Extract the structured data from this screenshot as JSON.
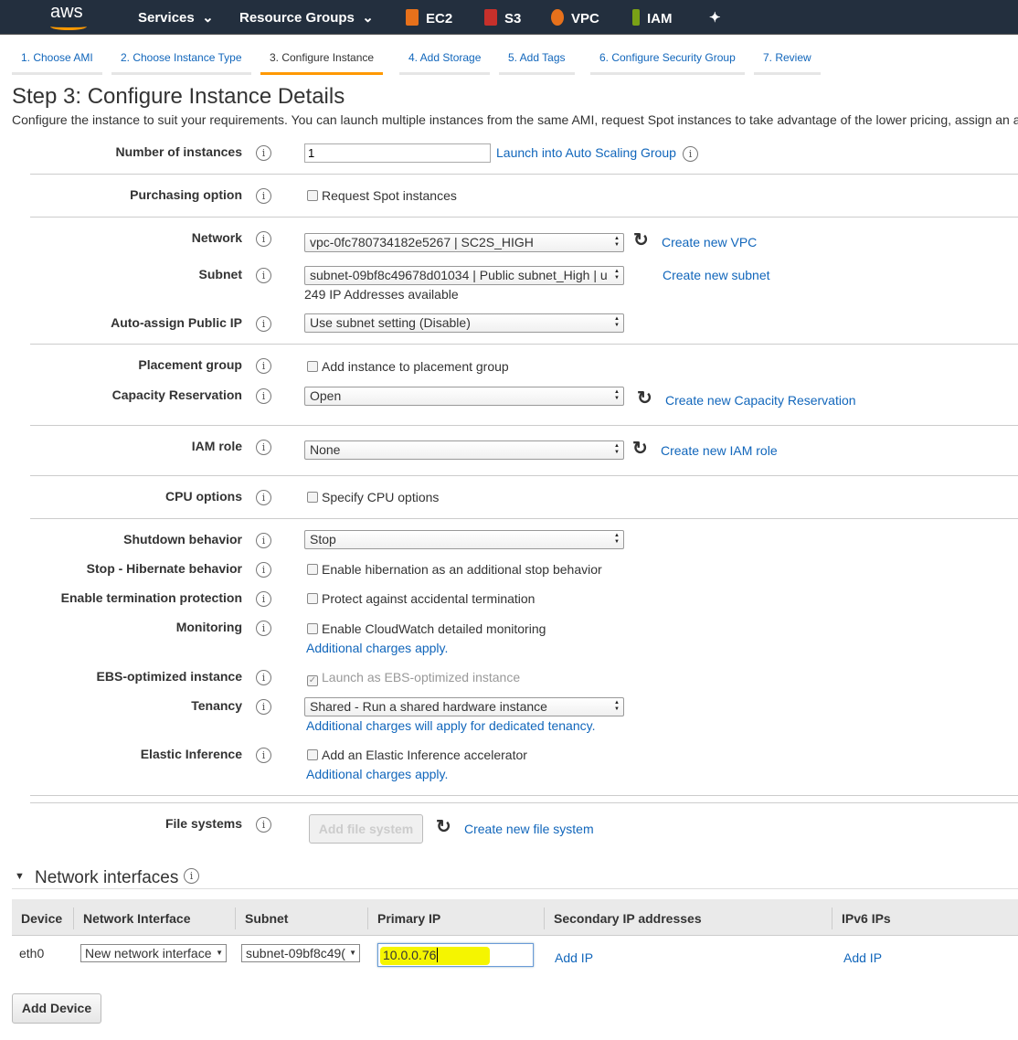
{
  "nav": {
    "logo": "aws",
    "services": "Services",
    "resource_groups": "Resource Groups",
    "ec2": "EC2",
    "s3": "S3",
    "vpc": "VPC",
    "iam": "IAM",
    "colors": {
      "bg": "#232f3e",
      "accent": "#ff9900"
    }
  },
  "steps": [
    "1. Choose AMI",
    "2. Choose Instance Type",
    "3. Configure Instance",
    "4. Add Storage",
    "5. Add Tags",
    "6. Configure Security Group",
    "7. Review"
  ],
  "title": "Step 3: Configure Instance Details",
  "description": "Configure the instance to suit your requirements. You can launch multiple instances from the same AMI, request Spot instances to take advantage of the lower pricing, assign an a",
  "form": {
    "num_instances": {
      "label": "Number of instances",
      "value": "1",
      "link": "Launch into Auto Scaling Group"
    },
    "purchasing": {
      "label": "Purchasing option",
      "checkbox": "Request Spot instances"
    },
    "network": {
      "label": "Network",
      "value": "vpc-0fc780734182e5267 | SC2S_HIGH",
      "link": "Create new VPC"
    },
    "subnet": {
      "label": "Subnet",
      "value": "subnet-09bf8c49678d01034 | Public subnet_High | u",
      "link": "Create new subnet",
      "note": "249 IP Addresses available"
    },
    "public_ip": {
      "label": "Auto-assign Public IP",
      "value": "Use subnet setting (Disable)"
    },
    "placement": {
      "label": "Placement group",
      "checkbox": "Add instance to placement group"
    },
    "capacity": {
      "label": "Capacity Reservation",
      "value": "Open",
      "link": "Create new Capacity Reservation"
    },
    "iam": {
      "label": "IAM role",
      "value": "None",
      "link": "Create new IAM role"
    },
    "cpu": {
      "label": "CPU options",
      "checkbox": "Specify CPU options"
    },
    "shutdown": {
      "label": "Shutdown behavior",
      "value": "Stop"
    },
    "hibernate": {
      "label": "Stop - Hibernate behavior",
      "checkbox": "Enable hibernation as an additional stop behavior"
    },
    "termination": {
      "label": "Enable termination protection",
      "checkbox": "Protect against accidental termination"
    },
    "monitoring": {
      "label": "Monitoring",
      "checkbox": "Enable CloudWatch detailed monitoring",
      "link": "Additional charges apply."
    },
    "ebs": {
      "label": "EBS-optimized instance",
      "checkbox": "Launch as EBS-optimized instance"
    },
    "tenancy": {
      "label": "Tenancy",
      "value": "Shared - Run a shared hardware instance",
      "link": "Additional charges will apply for dedicated tenancy."
    },
    "elastic": {
      "label": "Elastic Inference",
      "checkbox": "Add an Elastic Inference accelerator",
      "link": "Additional charges apply."
    },
    "files": {
      "label": "File systems",
      "button": "Add file system",
      "link": "Create new file system"
    }
  },
  "ni": {
    "title": "Network interfaces",
    "headers": [
      "Device",
      "Network Interface",
      "Subnet",
      "Primary IP",
      "Secondary IP addresses",
      "IPv6 IPs"
    ],
    "row": {
      "device": "eth0",
      "interface": "New network interface",
      "subnet": "subnet-09bf8c49(",
      "primary_ip": "10.0.0.76",
      "secondary": "Add IP",
      "ipv6": "Add IP"
    },
    "add_device": "Add Device"
  }
}
